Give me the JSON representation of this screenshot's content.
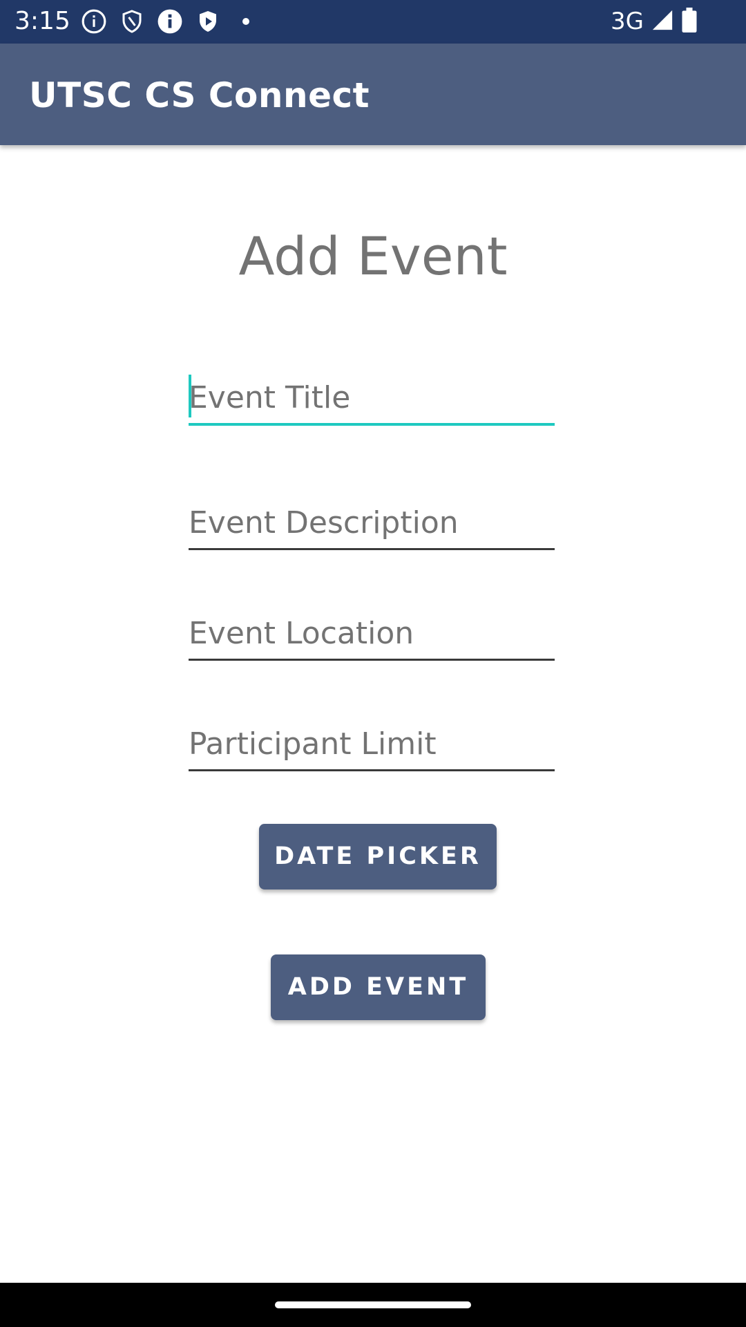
{
  "status_bar": {
    "time": "3:15",
    "network": "3G",
    "icons": [
      "info-icon",
      "shield-icon",
      "info-filled-icon",
      "play-shield-icon",
      "dot-icon",
      "signal-icon",
      "battery-icon"
    ]
  },
  "app_bar": {
    "title": "UTSC CS Connect"
  },
  "form": {
    "heading": "Add Event",
    "title_placeholder": "Event Title",
    "description_placeholder": "Event Description",
    "location_placeholder": "Event Location",
    "limit_placeholder": "Participant Limit",
    "date_picker_label": "DATE PICKER",
    "add_event_label": "ADD EVENT"
  },
  "colors": {
    "status_bar": "#213867",
    "app_bar": "#4d5e80",
    "button": "#4d5e80",
    "accent": "#1ec9c0",
    "placeholder_text": "#737373"
  }
}
